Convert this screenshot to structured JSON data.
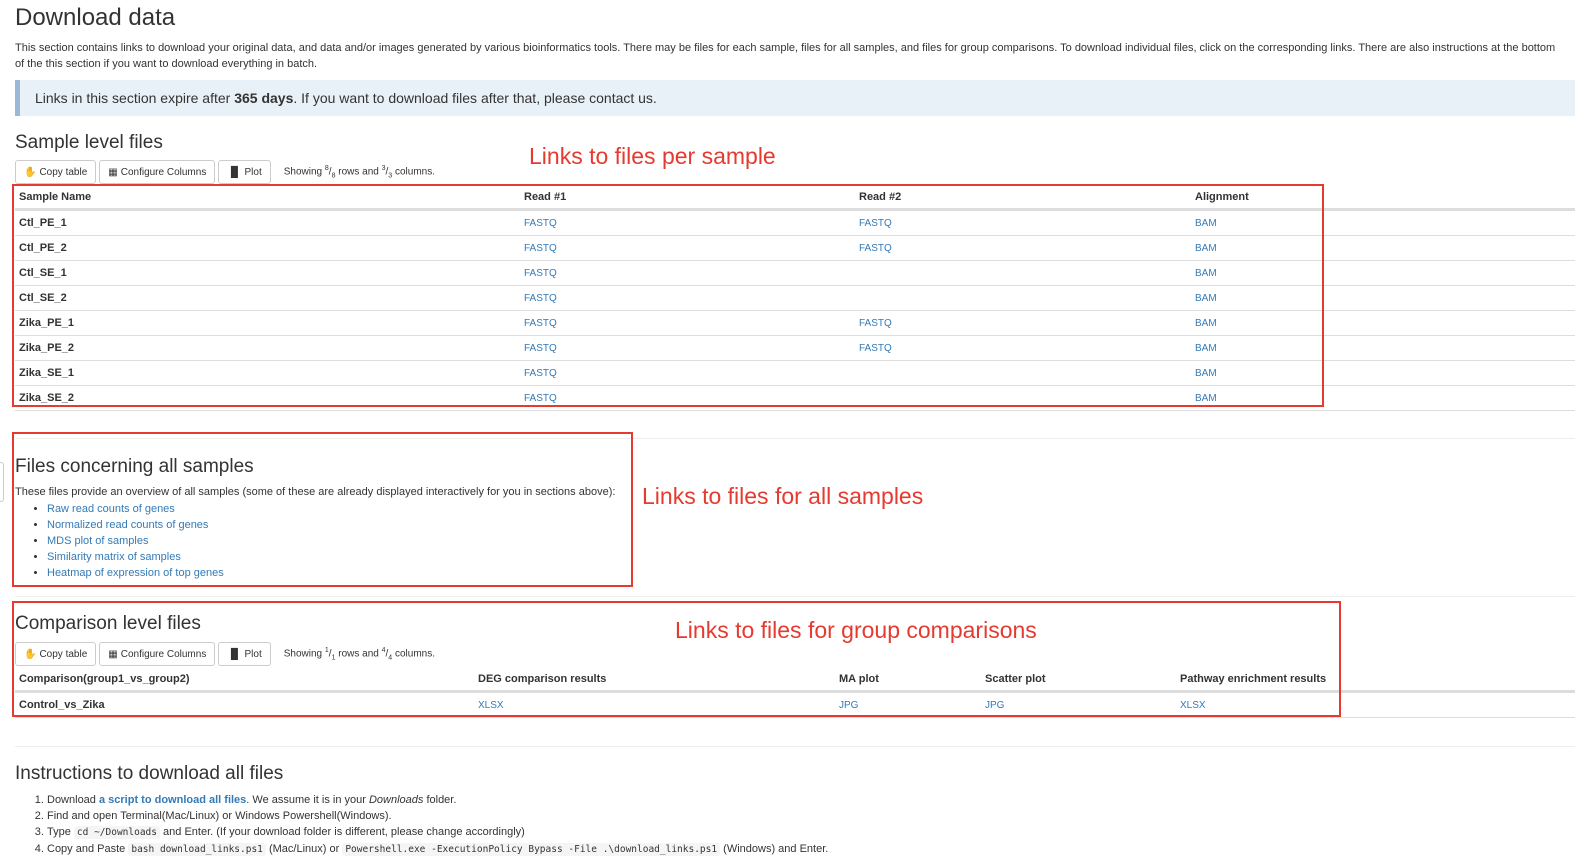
{
  "page": {
    "title": "Download data",
    "intro": "This section contains links to download your original data, and data and/or images generated by various bioinformatics tools. There may be files for each sample, files for all samples, and files for group comparisons. To download individual files, click on the corresponding links. There are also instructions at the bottom of the this section if you want to download everything in batch.",
    "callout": {
      "prefix": "Links in this section expire after ",
      "bold": "365 days",
      "suffix": ". If you want to download files after that, please contact us."
    }
  },
  "sample_level": {
    "heading": "Sample level files",
    "toolbar": {
      "copy_label": "Copy table",
      "configure_label": "Configure Columns",
      "plot_label": "Plot",
      "showing_prefix": "Showing ",
      "rows_shown": "8",
      "rows_total": "8",
      "rows_mid": " rows and ",
      "cols_shown": "3",
      "cols_total": "3",
      "cols_suffix": " columns."
    },
    "columns": [
      "Sample Name",
      "Read #1",
      "Read #2",
      "Alignment"
    ],
    "rows": [
      {
        "name": "Ctl_PE_1",
        "read1": "FASTQ",
        "read2": "FASTQ",
        "alignment": "BAM"
      },
      {
        "name": "Ctl_PE_2",
        "read1": "FASTQ",
        "read2": "FASTQ",
        "alignment": "BAM"
      },
      {
        "name": "Ctl_SE_1",
        "read1": "FASTQ",
        "read2": "",
        "alignment": "BAM"
      },
      {
        "name": "Ctl_SE_2",
        "read1": "FASTQ",
        "read2": "",
        "alignment": "BAM"
      },
      {
        "name": "Zika_PE_1",
        "read1": "FASTQ",
        "read2": "FASTQ",
        "alignment": "BAM"
      },
      {
        "name": "Zika_PE_2",
        "read1": "FASTQ",
        "read2": "FASTQ",
        "alignment": "BAM"
      },
      {
        "name": "Zika_SE_1",
        "read1": "FASTQ",
        "read2": "",
        "alignment": "BAM"
      },
      {
        "name": "Zika_SE_2",
        "read1": "FASTQ",
        "read2": "",
        "alignment": "BAM"
      }
    ]
  },
  "all_samples": {
    "heading": "Files concerning all samples",
    "description": "These files provide an overview of all samples (some of these are already displayed interactively for you in sections above):",
    "links": [
      "Raw read counts of genes",
      "Normalized read counts of genes",
      "MDS plot of samples",
      "Similarity matrix of samples",
      "Heatmap of expression of top genes"
    ]
  },
  "comparison_level": {
    "heading": "Comparison level files",
    "toolbar": {
      "copy_label": "Copy table",
      "configure_label": "Configure Columns",
      "plot_label": "Plot",
      "showing_prefix": "Showing ",
      "rows_shown": "1",
      "rows_total": "1",
      "rows_mid": " rows and ",
      "cols_shown": "4",
      "cols_total": "4",
      "cols_suffix": " columns."
    },
    "columns": [
      "Comparison(group1_vs_group2)",
      "DEG comparison results",
      "MA plot",
      "Scatter plot",
      "Pathway enrichment results"
    ],
    "rows": [
      {
        "name": "Control_vs_Zika",
        "deg": "XLSX",
        "ma": "JPG",
        "scatter": "JPG",
        "pathway": "XLSX"
      }
    ]
  },
  "instructions": {
    "heading": "Instructions to download all files",
    "step1": {
      "prefix": "Download ",
      "link": "a script to download all files",
      "middle": ". We assume it is in your ",
      "italic": "Downloads",
      "suffix": " folder."
    },
    "step2": "Find and open Terminal(Mac/Linux) or Windows Powershell(Windows).",
    "step3": {
      "prefix": "Type ",
      "code": "cd ~/Downloads",
      "suffix": " and Enter. (If your download folder is different, please change accordingly)"
    },
    "step4": {
      "prefix": "Copy and Paste ",
      "code1": "bash download_links.ps1",
      "middle": " (Mac/Linux) or ",
      "code2": "Powershell.exe -ExecutionPolicy Bypass -File .\\download_links.ps1",
      "suffix": " (Windows) and Enter."
    }
  },
  "annotations": {
    "per_sample": "Links to files per sample",
    "all_samples": "Links to files for all samples",
    "group_comparisons": "Links to files for group comparisons",
    "color": "#e53a2f"
  },
  "colors": {
    "link": "#337ab7",
    "callout_bg": "#e9f1f8",
    "callout_border": "#9ab9d6"
  }
}
